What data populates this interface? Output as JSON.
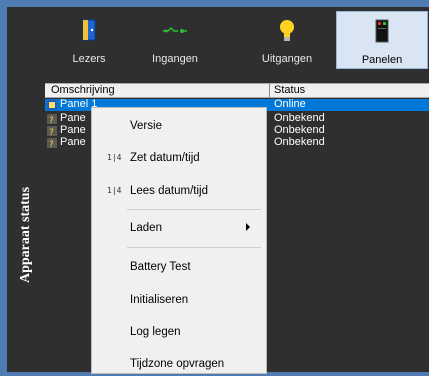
{
  "sidebar": {
    "title": "Apparaat status"
  },
  "toolbar": {
    "buttons": [
      {
        "label": "Lezers",
        "icon": "door-icon"
      },
      {
        "label": "Ingangen",
        "icon": "inputs-icon"
      },
      {
        "label": "Uitgangen",
        "icon": "lightbulb-icon"
      },
      {
        "label": "Panelen",
        "icon": "panel-icon",
        "active": true
      }
    ]
  },
  "grid": {
    "columns": [
      "Omschrijving",
      "Status"
    ],
    "rows": [
      {
        "name": "Panel 1",
        "status": "Online",
        "selected": true
      },
      {
        "name": "Pane",
        "status": "Onbekend"
      },
      {
        "name": "Pane",
        "status": "Onbekend"
      },
      {
        "name": "Pane",
        "status": "Onbekend"
      }
    ]
  },
  "context_menu": {
    "items": [
      {
        "label": "Versie"
      },
      {
        "label": "Zet datum/tijd",
        "icon_text": "1|4"
      },
      {
        "label": "Lees datum/tijd",
        "icon_text": "1|4"
      },
      {
        "label": "Laden",
        "submenu": true
      },
      {
        "label": "Battery Test"
      },
      {
        "label": "Initialiseren"
      },
      {
        "label": "Log legen"
      },
      {
        "label": "Tijdzone opvragen"
      }
    ]
  },
  "colors": {
    "background": "#2f2f2f",
    "border": "#4f7db3",
    "selection": "#0078d7",
    "menu": "#f0f0f0"
  }
}
